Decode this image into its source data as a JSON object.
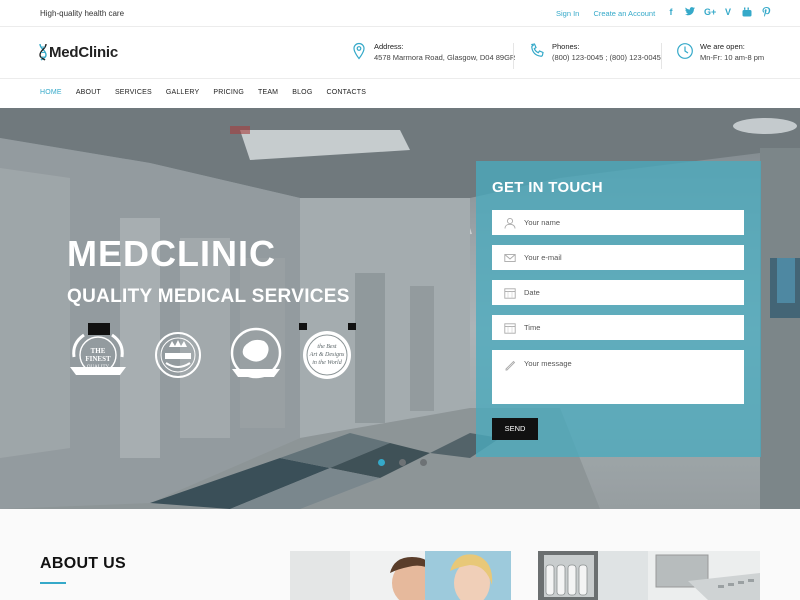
{
  "topbar": {
    "tagline": "High-quality health care",
    "sign_in": "Sign In",
    "create_account": "Create an Account",
    "social_icons": [
      "facebook-icon",
      "twitter-icon",
      "google-plus-icon",
      "vine-icon",
      "youtube-icon",
      "pinterest-icon"
    ]
  },
  "header": {
    "logo": "MedClinic",
    "address_label": "Address:",
    "address_value": "4578 Marmora Road, Glasgow, D04 89GR",
    "phones_label": "Phones:",
    "phones_value": "(800) 123-0045 ; (800) 123-0045",
    "hours_label": "We are open:",
    "hours_value": "Mn-Fr: 10 am-8 pm"
  },
  "nav": {
    "items": [
      "HOME",
      "ABOUT",
      "SERVICES",
      "GALLERY",
      "PRICING",
      "TEAM",
      "BLOG",
      "CONTACTS"
    ],
    "active": "HOME"
  },
  "hero": {
    "title": "MEDCLINIC",
    "subtitle": "QUALITY MEDICAL SERVICES",
    "badge_texts": [
      "THE FINEST QUALITY",
      "The Best Art & Designs in the World"
    ],
    "slides": 3,
    "active_slide": 1
  },
  "contact_form": {
    "title": "GET IN TOUCH",
    "name_placeholder": "Your name",
    "email_placeholder": "Your e-mail",
    "date_placeholder": "Date",
    "time_placeholder": "Time",
    "message_placeholder": "Your message",
    "submit": "SEND"
  },
  "about": {
    "title": "ABOUT US"
  },
  "colors": {
    "accent": "#35a9c9",
    "form_overlay": "#4aaabe",
    "button_dark": "#111111"
  }
}
